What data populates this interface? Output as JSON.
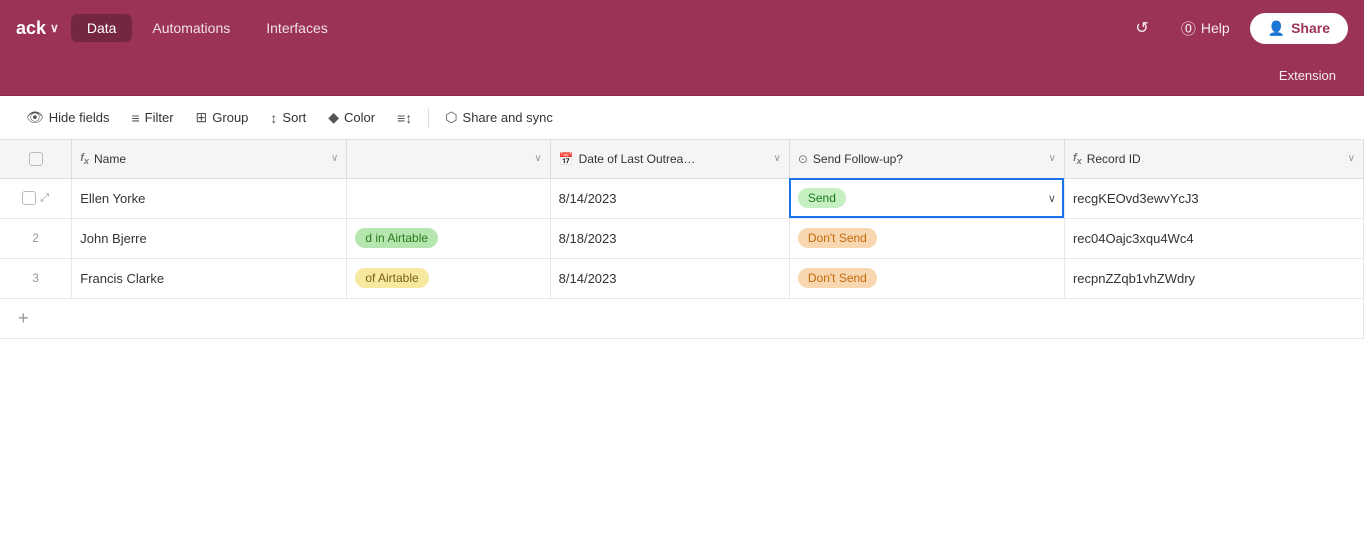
{
  "nav": {
    "brand": "ack",
    "brand_chevron": "∨",
    "tabs": [
      {
        "id": "data",
        "label": "Data",
        "active": true
      },
      {
        "id": "automations",
        "label": "Automations",
        "active": false
      },
      {
        "id": "interfaces",
        "label": "Interfaces",
        "active": false
      }
    ],
    "history_label": "",
    "help_label": "Help",
    "share_label": "Share",
    "extension_label": "Extension"
  },
  "toolbar": {
    "hide_fields": "Hide fields",
    "filter": "Filter",
    "group": "Group",
    "sort": "Sort",
    "color": "Color",
    "fields_icon": "≡↕",
    "share_sync": "Share and sync"
  },
  "table": {
    "columns": [
      {
        "id": "check",
        "label": "",
        "icon": ""
      },
      {
        "id": "name",
        "label": "Name",
        "icon": "fx"
      },
      {
        "id": "status",
        "label": "",
        "icon": ""
      },
      {
        "id": "date",
        "label": "Date of Last Outrea…",
        "icon": "📅"
      },
      {
        "id": "followup",
        "label": "Send Follow-up?",
        "icon": "⊙"
      },
      {
        "id": "record",
        "label": "Record ID",
        "icon": "fx"
      }
    ],
    "rows": [
      {
        "num": "",
        "name": "Ellen Yorke",
        "status": "",
        "status_badge": "",
        "date": "8/14/2023",
        "followup": "Send",
        "followup_type": "green",
        "record": "recgKEOvd3ewvYcJ3",
        "focused": true
      },
      {
        "num": "2",
        "name": "John Bjerre",
        "status": "d in Airtable",
        "status_badge": "yellow-green",
        "date": "8/18/2023",
        "followup": "Don't Send",
        "followup_type": "orange",
        "record": "rec04Oajc3xqu4Wc4",
        "focused": false
      },
      {
        "num": "3",
        "name": "Francis Clarke",
        "status": "of Airtable",
        "status_badge": "yellow",
        "date": "8/14/2023",
        "followup": "Don't Send",
        "followup_type": "orange",
        "record": "recpnZZqb1vhZWdry",
        "focused": false
      }
    ]
  }
}
